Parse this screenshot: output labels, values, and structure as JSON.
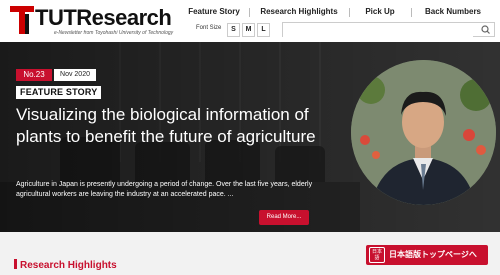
{
  "brand": {
    "name": "TUTResearch",
    "tagline": "e-Newsletter from Toyohashi University of Technology",
    "accent_color": "#c8102e"
  },
  "nav": {
    "items": [
      "Feature Story",
      "Research Highlights",
      "Pick Up",
      "Back Numbers"
    ]
  },
  "font_size": {
    "label": "Font Size",
    "options": [
      "S",
      "M",
      "L"
    ]
  },
  "search": {
    "placeholder": "",
    "icon": "search-icon"
  },
  "hero": {
    "issue_number": "No.23",
    "issue_date": "Nov 2020",
    "category": "FEATURE STORY",
    "title": "Visualizing the biological information of plants to benefit the future of agriculture",
    "excerpt": "Agriculture in Japan is presently undergoing a period of change. Over the last five years, elderly agricultural workers are leaving the industry at an accelerated pace. ...",
    "read_more": "Read More..."
  },
  "sections": {
    "research_highlights": "Research Highlights"
  },
  "japanese_link": {
    "icon_text": "日本語",
    "label": "日本語版トップページへ"
  }
}
